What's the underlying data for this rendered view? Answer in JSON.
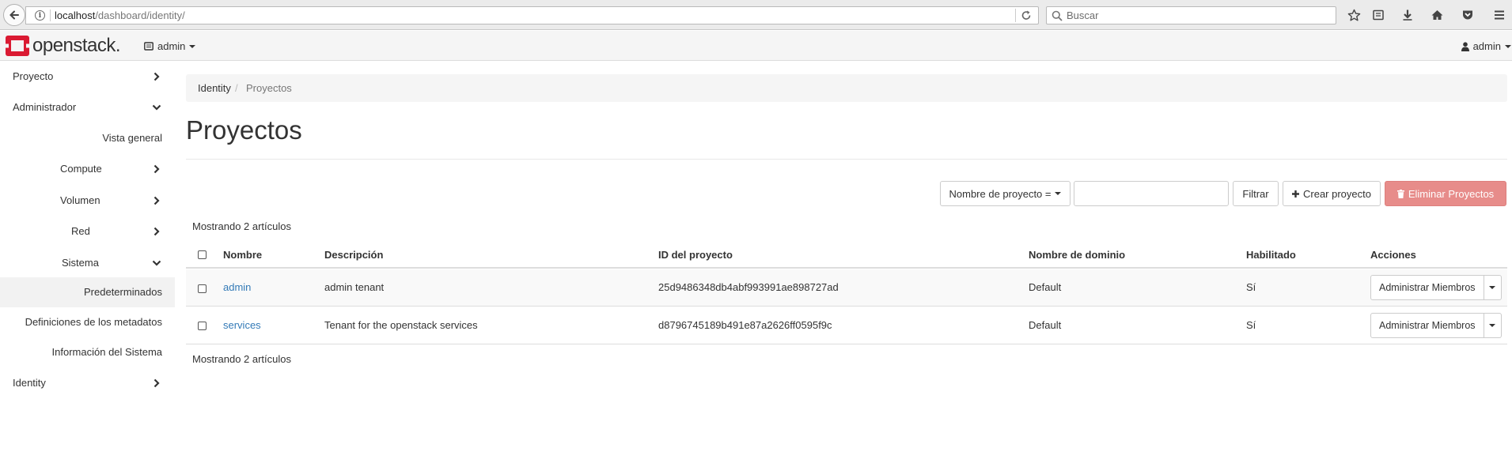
{
  "browser": {
    "url_host": "localhost",
    "url_path": "/dashboard/identity/",
    "search_placeholder": "Buscar"
  },
  "topnav": {
    "logo_text": "openstack.",
    "project": "admin",
    "user": "admin"
  },
  "sidebar": {
    "items": [
      {
        "label": "Proyecto",
        "icon": "chevron-right-icon"
      },
      {
        "label": "Administrador",
        "icon": "chevron-down-icon"
      },
      {
        "label": "Vista general"
      },
      {
        "label": "Compute",
        "icon": "chevron-right-icon"
      },
      {
        "label": "Volumen",
        "icon": "chevron-right-icon"
      },
      {
        "label": "Red",
        "icon": "chevron-right-icon"
      },
      {
        "label": "Sistema",
        "icon": "chevron-down-icon"
      },
      {
        "label": "Predeterminados"
      },
      {
        "label": "Definiciones de los metadatos"
      },
      {
        "label": "Información del Sistema"
      },
      {
        "label": "Identity",
        "icon": "chevron-right-icon"
      }
    ]
  },
  "breadcrumb": {
    "root": "Identity",
    "separator": "/",
    "current": "Proyectos"
  },
  "page": {
    "title": "Proyectos"
  },
  "toolbar": {
    "filter_select": "Nombre de proyecto =",
    "filter_value": "",
    "filter_button": "Filtrar",
    "create_button": "Crear proyecto",
    "delete_button": "Eliminar Proyectos"
  },
  "table": {
    "count_top": "Mostrando 2 artículos",
    "count_bottom": "Mostrando 2 artículos",
    "headers": [
      "Nombre",
      "Descripción",
      "ID del proyecto",
      "Nombre de dominio",
      "Habilitado",
      "Acciones"
    ],
    "rows": [
      {
        "name": "admin",
        "description": "admin tenant",
        "id": "25d9486348db4abf993991ae898727ad",
        "domain": "Default",
        "enabled": "Sí",
        "action": "Administrar Miembros"
      },
      {
        "name": "services",
        "description": "Tenant for the openstack services",
        "id": "d8796745189b491e87a2626ff0595f9c",
        "domain": "Default",
        "enabled": "Sí",
        "action": "Administrar Miembros"
      }
    ]
  },
  "colors": {
    "link": "#337ab7",
    "danger": "#e78c8a",
    "brand_red": "#da1a32"
  }
}
